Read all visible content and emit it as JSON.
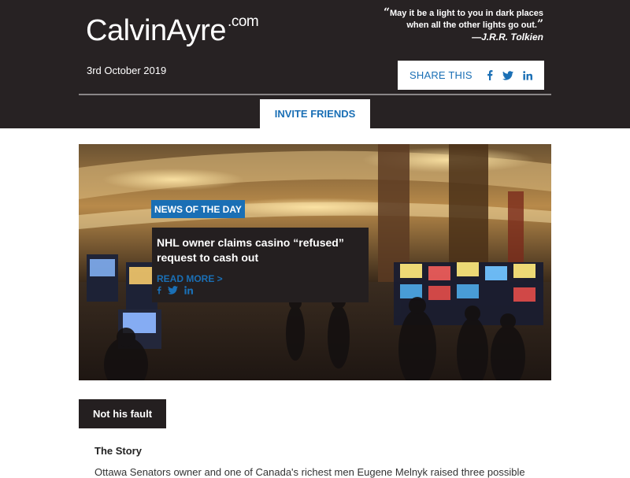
{
  "header": {
    "logo_main": "CalvinAyre",
    "logo_suffix": ".com",
    "quote_open": "“",
    "quote_line1": "May it be a light to you in dark places",
    "quote_line2": "when all the other lights go out.",
    "quote_close": "”",
    "quote_author": "—J.R.R. Tolkien",
    "date": "3rd October 2019",
    "share_label": "SHARE THIS",
    "share_icons": [
      "facebook-icon",
      "twitter-icon",
      "linkedin-icon"
    ],
    "invite_label": "INVITE FRIENDS"
  },
  "hero": {
    "tag": "NEWS OF THE DAY",
    "title": "NHL owner claims casino “refused” request to cash out",
    "read_more": "READ MORE >"
  },
  "section": {
    "label": "Not his fault",
    "story_heading": "The Story",
    "story_text": "Ottawa Senators owner and one of Canada's richest men Eugene Melnyk raised three possible"
  },
  "colors": {
    "header_bg": "#272223",
    "accent": "#1a6fb5",
    "card_bg": "#241f20"
  }
}
